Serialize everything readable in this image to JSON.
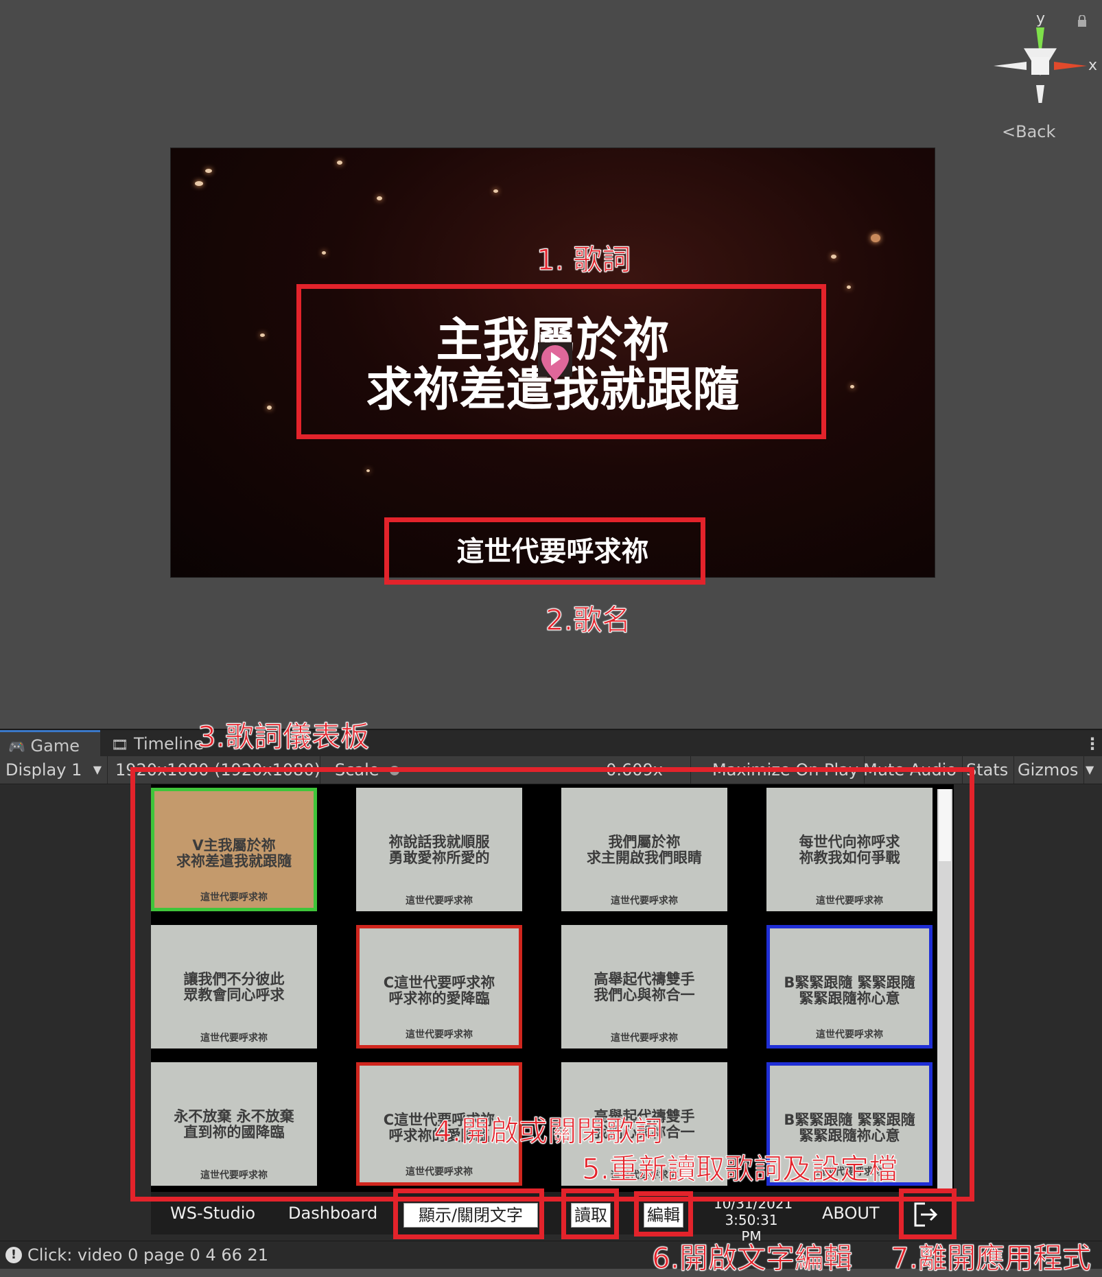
{
  "gizmo": {
    "y_label": "y",
    "x_label": "x",
    "back_label": "Back"
  },
  "game_view": {
    "lyric_line1": "主我屬於祢",
    "lyric_line2": "求祢差遣我就跟隨",
    "song_title": "這世代要呼求祢"
  },
  "annotations": {
    "lyrics": "1. 歌詞",
    "song_name": "2.歌名",
    "dashboard": "3.歌詞儀表板",
    "toggle_lyrics": "4.開啟或關閉歌詞",
    "reload": "5.重新讀取歌詞及設定檔",
    "text_edit": "6.開啟文字編輯",
    "exit_app": "7.離開應用程式"
  },
  "editor": {
    "tabs": [
      {
        "label": "Game"
      },
      {
        "label": "Timeline"
      }
    ],
    "toolbar": {
      "display": "Display 1",
      "resolution": "1920x1080 (1920x1080)",
      "scale_label": "Scale",
      "scale_value": "0.609x",
      "maximize": "Maximize On Play",
      "mute": "Mute Audio",
      "stats": "Stats",
      "gizmos": "Gizmos"
    }
  },
  "cards": [
    {
      "lines": "V主我屬於祢\n求祢差遣我就跟隨",
      "song": "這世代要呼求祢",
      "border": "#3fc53a",
      "bg": "#c49a6c"
    },
    {
      "lines": "祢說話我就順服\n勇敢愛祢所愛的",
      "song": "這世代要呼求祢",
      "border": "",
      "bg": ""
    },
    {
      "lines": "我們屬於祢\n求主開啟我們眼睛",
      "song": "這世代要呼求祢",
      "border": "",
      "bg": ""
    },
    {
      "lines": "每世代向祢呼求\n祢教我如何爭戰",
      "song": "這世代要呼求祢",
      "border": "",
      "bg": ""
    },
    {
      "lines": "讓我們不分彼此\n眾教會同心呼求",
      "song": "這世代要呼求祢",
      "border": "",
      "bg": ""
    },
    {
      "lines": "C這世代要呼求祢\n呼求祢的愛降臨",
      "song": "這世代要呼求祢",
      "border": "#d0261e",
      "bg": ""
    },
    {
      "lines": "高舉起代禱雙手\n我們心與祢合一",
      "song": "這世代要呼求祢",
      "border": "",
      "bg": ""
    },
    {
      "lines": "B緊緊跟隨 緊緊跟隨\n緊緊跟隨祢心意",
      "song": "這世代要呼求祢",
      "border": "#1f2fd6",
      "bg": ""
    },
    {
      "lines": "永不放棄 永不放棄\n直到祢的國降臨",
      "song": "這世代要呼求祢",
      "border": "",
      "bg": ""
    },
    {
      "lines": "C這世代要呼求祢\n呼求祢的愛降臨",
      "song": "這世代要呼求祢",
      "border": "#d0261e",
      "bg": ""
    },
    {
      "lines": "高舉起代禱雙手\n我們心與祢合一",
      "song": "這世代要呼求祢",
      "border": "",
      "bg": ""
    },
    {
      "lines": "B緊緊跟隨 緊緊跟隨\n緊緊跟隨祢心意",
      "song": "這世代要呼求祢",
      "border": "#1f2fd6",
      "bg": ""
    }
  ],
  "dashboard_bar": {
    "brand": "WS-Studio",
    "dashboard": "Dashboard",
    "toggle_text": "顯示/關閉文字",
    "reload": "讀取",
    "edit": "編輯",
    "date": "10/31/2021",
    "time": "3:50:31 PM",
    "about": "ABOUT"
  },
  "status_bar": {
    "message": "Click: video 0 page 0 4 66 21"
  }
}
